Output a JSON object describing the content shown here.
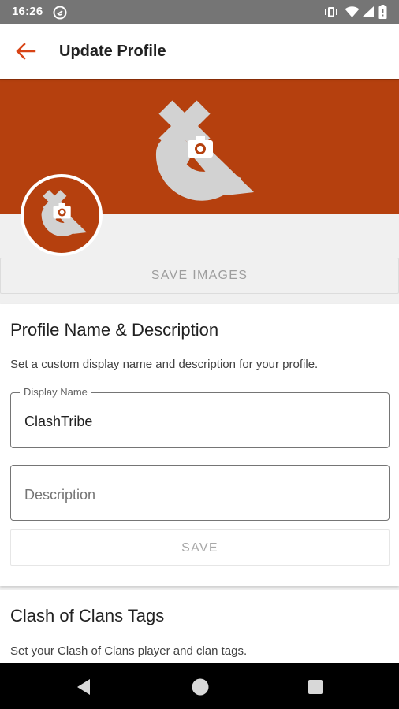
{
  "status_bar": {
    "time": "16:26",
    "icons": [
      "sync-icon",
      "vibrate-icon",
      "wifi-icon",
      "signal-icon",
      "battery-icon"
    ]
  },
  "app_bar": {
    "title": "Update Profile",
    "back_icon": "arrow-back-icon",
    "accent_color": "#d84315"
  },
  "header": {
    "banner_color": "#b5400e",
    "banner_icon": "clash-tribe-logo",
    "avatar_icon": "clash-tribe-logo",
    "camera_icon": "camera-icon"
  },
  "save_images": {
    "label": "SAVE IMAGES"
  },
  "profile_section": {
    "title": "Profile Name & Description",
    "description": "Set a custom display name and description for your profile.",
    "display_name": {
      "label": "Display Name",
      "value": "ClashTribe"
    },
    "description_field": {
      "placeholder": "Description"
    },
    "save_label": "SAVE"
  },
  "tags_section": {
    "title": "Clash of Clans Tags",
    "description": "Set your Clash of Clans player and clan tags."
  },
  "nav_bar": {
    "icons": [
      "back-triangle-icon",
      "home-circle-icon",
      "recents-square-icon"
    ]
  }
}
